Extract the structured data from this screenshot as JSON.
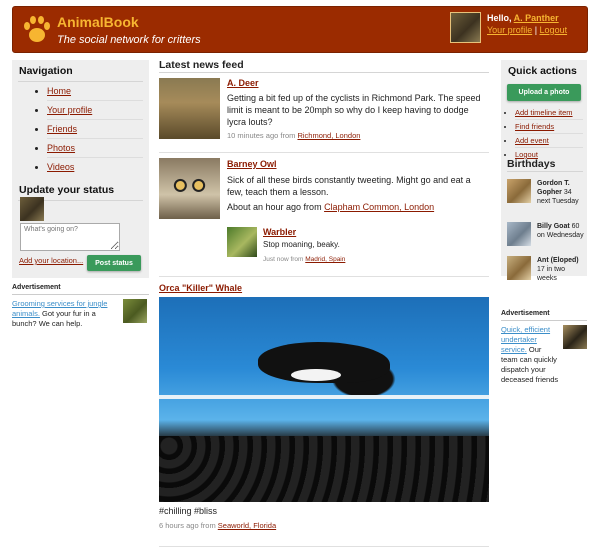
{
  "header": {
    "brand": "AnimalBook",
    "tagline": "The social network for critters",
    "hello_prefix": "Hello, ",
    "user_name": "A. Panther",
    "your_profile": "Your profile",
    "separator": " | ",
    "logout": "Logout"
  },
  "left": {
    "nav_title": "Navigation",
    "nav_items": [
      "Home",
      "Your profile",
      "Friends",
      "Photos",
      "Videos"
    ],
    "status_title": "Update your status",
    "status_placeholder": "What's going on?",
    "add_location": "Add your location...",
    "post_status": "Post status",
    "ad_title": "Advertisement",
    "ad_link": "Grooming services for jungle animals.",
    "ad_text": " Got your fur in a bunch? We can help."
  },
  "feed": {
    "title": "Latest news feed",
    "posts": [
      {
        "name": "A. Deer",
        "text": "Getting a bit fed up of the cyclists in Richmond Park. The speed limit is meant to be 20mph so why do I keep having to dodge lycra louts?",
        "meta_prefix": "10 minutes ago from ",
        "location": "Richmond, London"
      },
      {
        "name": "Barney Owl",
        "text": "Sick of all these birds constantly tweeting. Might go and eat a few, teach them a lesson.",
        "meta_prefix": "About an hour ago from ",
        "location": "Clapham Common, London"
      },
      {
        "name": "Orca \"Killer\" Whale",
        "caption": "#chilling #bliss",
        "meta_prefix": "6 hours ago from ",
        "location": "Seaworld, Florida"
      }
    ],
    "reply": {
      "name": "Warbler",
      "text": "Stop moaning, beaky.",
      "meta_prefix": "Just now from ",
      "location": "Madrid, Spain"
    }
  },
  "right": {
    "quick_title": "Quick actions",
    "upload_photo": "Upload a photo",
    "actions": [
      "Add timeline item",
      "Find friends",
      "Add event",
      "Logout"
    ],
    "birthdays_title": "Birthdays",
    "birthdays": [
      {
        "name": "Gordon T. Gopher",
        "when": " 34 next Tuesday"
      },
      {
        "name": "Billy Goat",
        "when": " 60 on Wednesday"
      },
      {
        "name": "Ant (Eloped)",
        "when": " 17 in two weeks"
      }
    ],
    "ad_title": "Advertisement",
    "ad_link": "Quick, efficient undertaker service.",
    "ad_text": " Our team can quickly dispatch your deceased friends"
  }
}
